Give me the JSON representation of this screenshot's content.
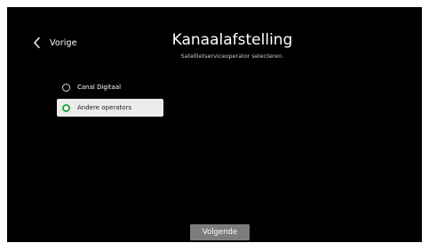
{
  "header": {
    "back_label": "Vorige",
    "back_icon": "chevron-left-icon",
    "title": "Kanaalafstelling",
    "subtitle": "Satellietserviceoperator selecteren."
  },
  "options": [
    {
      "label": "Canal Digitaal",
      "selected": false
    },
    {
      "label": "Andere operators",
      "selected": true
    }
  ],
  "footer": {
    "next_label": "Volgende"
  },
  "colors": {
    "background": "#000000",
    "selected_row": "#ececec",
    "radio_selected": "#2ca44a",
    "button": "#7d7d7d"
  }
}
